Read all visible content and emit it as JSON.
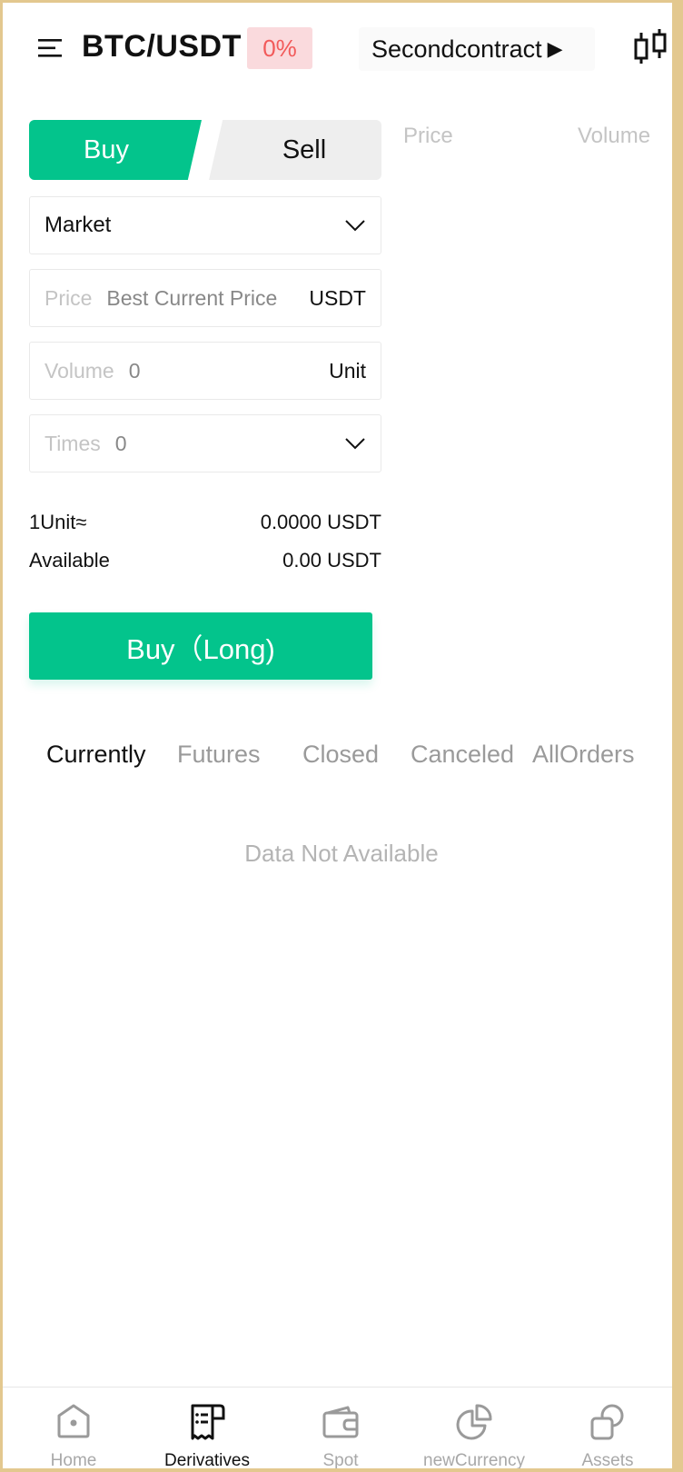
{
  "header": {
    "pair": "BTC/USDT",
    "change": "0%",
    "contract_mode": "Secondcontract",
    "contract_arrow": "▶"
  },
  "trade": {
    "buy_label": "Buy",
    "sell_label": "Sell",
    "order_type": "Market",
    "price_label": "Price",
    "price_value": "Best Current Price",
    "price_unit": "USDT",
    "volume_label": "Volume",
    "volume_value": "0",
    "volume_unit": "Unit",
    "times_label": "Times",
    "times_value": "0",
    "unit_rate_label": "1Unit≈",
    "unit_rate_value": "0.0000 USDT",
    "available_label": "Available",
    "available_value": "0.00 USDT",
    "submit_label": "Buy（Long)"
  },
  "orderbook": {
    "price_header": "Price",
    "volume_header": "Volume"
  },
  "orders": {
    "tabs": [
      "Currently",
      "Futures",
      "Closed",
      "Canceled",
      "AllOrders"
    ],
    "active_tab": "Currently",
    "empty_text": "Data Not Available"
  },
  "nav": {
    "items": [
      {
        "label": "Home",
        "icon": "home-icon"
      },
      {
        "label": "Derivatives",
        "icon": "derivatives-icon"
      },
      {
        "label": "Spot",
        "icon": "wallet-icon"
      },
      {
        "label": "newCurrency",
        "icon": "pie-icon"
      },
      {
        "label": "Assets",
        "icon": "assets-icon"
      }
    ],
    "active": "Derivatives"
  },
  "colors": {
    "accent": "#03c48c",
    "down": "#f25a5a",
    "frame": "#e3c88f"
  }
}
